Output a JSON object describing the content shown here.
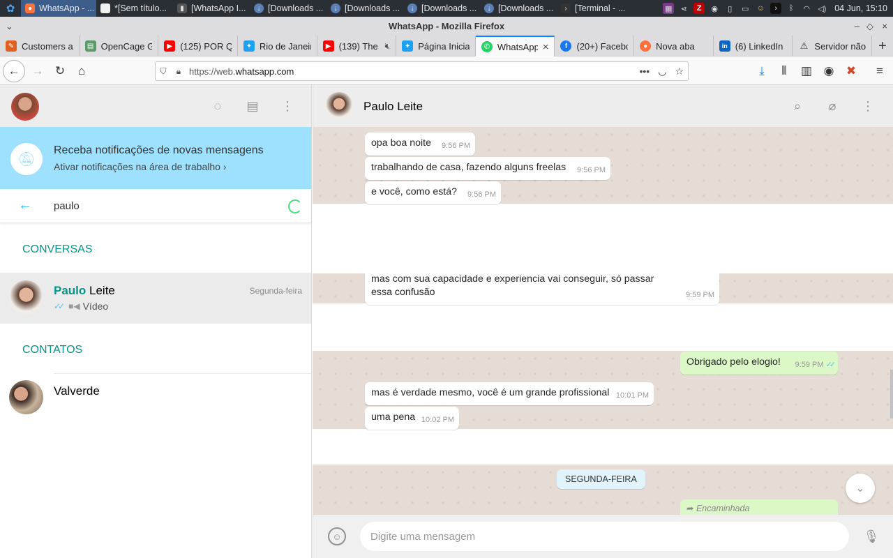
{
  "taskbar": {
    "tasks": [
      {
        "label": "WhatsApp - ...",
        "color": "#ff7139",
        "active": true
      },
      {
        "label": "*[Sem título...",
        "color": "#f0f0f0"
      },
      {
        "label": "[WhatsApp I...",
        "color": "#555555"
      },
      {
        "label": "[Downloads ...",
        "color": "#5b7fb5"
      },
      {
        "label": "[Downloads ...",
        "color": "#5b7fb5"
      },
      {
        "label": "[Downloads ...",
        "color": "#5b7fb5"
      },
      {
        "label": "[Downloads ...",
        "color": "#5b7fb5"
      },
      {
        "label": "[Terminal - ...",
        "color": "#333333"
      }
    ],
    "clock": "04 Jun, 15:10"
  },
  "browser": {
    "window_title": "WhatsApp - Mozilla Firefox",
    "tabs": [
      {
        "label": "Customers a",
        "fav": "#e06020",
        "glyph": "✎"
      },
      {
        "label": "OpenCage G",
        "fav": "#5a9a6a",
        "glyph": "▤"
      },
      {
        "label": "(125) POR Q",
        "fav": "#ff0000",
        "glyph": "▶"
      },
      {
        "label": "Rio de Janeir",
        "fav": "#1da1f2",
        "glyph": "✦"
      },
      {
        "label": "(139) The",
        "fav": "#ff0000",
        "glyph": "▶"
      },
      {
        "label": "Página Inicia",
        "fav": "#1da1f2",
        "glyph": "✦"
      },
      {
        "label": "WhatsApp",
        "fav": "#25d366",
        "glyph": "✆",
        "active": true
      },
      {
        "label": "(20+) Facebo",
        "fav": "#1877f2",
        "glyph": "f"
      },
      {
        "label": "Nova aba",
        "fav": "#ff7139",
        "glyph": "●"
      },
      {
        "label": "(6) LinkedIn",
        "fav": "#0a66c2",
        "glyph": "in"
      },
      {
        "label": "Servidor não",
        "fav": "#333333",
        "glyph": "⚠"
      }
    ],
    "url_scheme": "https://web.",
    "url_host": "whatsapp.com"
  },
  "left": {
    "notification_title": "Receba notificações de novas mensagens",
    "notification_link": "Ativar notificações na área de trabalho ›",
    "search_value": "paulo",
    "section_chats": "CONVERSAS",
    "chat": {
      "name_highlight": "Paulo",
      "name_rest": " Leite",
      "date": "Segunda-feira",
      "preview": "Vídeo"
    },
    "section_contacts": "CONTATOS",
    "contact": {
      "name": "Valverde"
    }
  },
  "right": {
    "contact_name": "Paulo Leite",
    "messages": [
      {
        "text": "opa boa noite",
        "time": "9:56 PM"
      },
      {
        "text": "trabalhando de casa, fazendo alguns freelas",
        "time": "9:56 PM"
      },
      {
        "text": "e você, como está?",
        "time": "9:56 PM"
      },
      {
        "text": "mas com sua capacidade e experiencia vai conseguir, só passar essa confusão",
        "time": "9:59 PM"
      },
      {
        "text": "Obrigado pelo elogio!",
        "time": "9:59 PM"
      },
      {
        "text": "mas é verdade mesmo, você é um grande profissional",
        "time": "10:01 PM"
      },
      {
        "text": "uma pena",
        "time": "10:02 PM"
      }
    ],
    "day_label": "SEGUNDA-FEIRA",
    "forwarded_label": "Encaminhada",
    "composer_placeholder": "Digite uma mensagem"
  },
  "colors": {
    "accent": "#009688",
    "notif_bg": "#9de1fe",
    "bubble_out": "#dcf8c6",
    "chat_bg": "#e5ddd5"
  }
}
